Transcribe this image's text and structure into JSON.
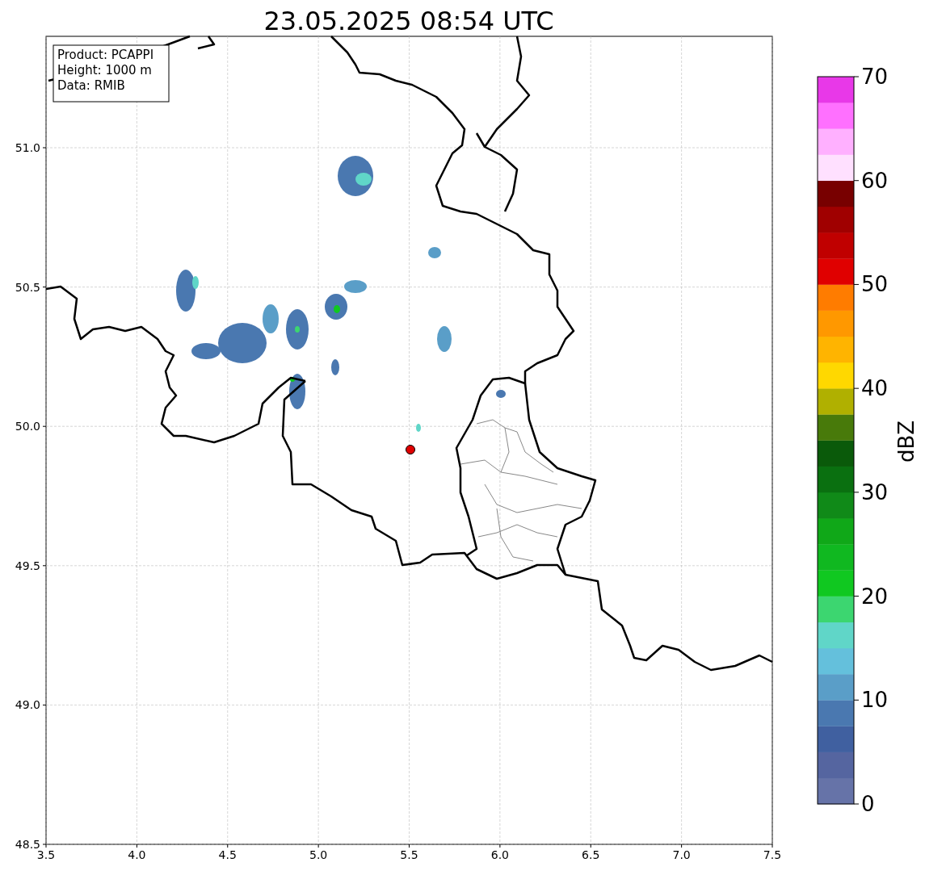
{
  "title": "23.05.2025 08:54 UTC",
  "info_box": [
    "Product: PCAPPI",
    "Height: 1000 m",
    "Data: RMIB"
  ],
  "map": {
    "ytick_labels": [
      "51.0",
      "50.5",
      "50.0",
      "49.5",
      "49.0",
      "48.5"
    ],
    "xtick_labels": [
      "3.5",
      "4.0",
      "4.5",
      "5.0",
      "5.5",
      "6.0",
      "6.5",
      "7.0",
      "7.5"
    ]
  },
  "colorbar": {
    "tick_labels": [
      "70",
      "60",
      "50",
      "40",
      "30",
      "20",
      "10",
      "0"
    ],
    "label": "dBZ"
  }
}
